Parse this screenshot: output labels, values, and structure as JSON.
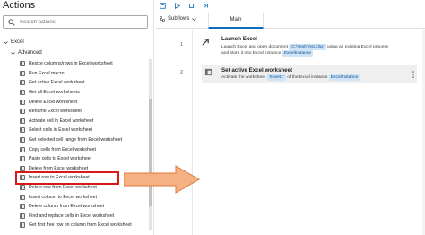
{
  "panel": {
    "title": "Actions",
    "search_placeholder": "Search actions",
    "category": "Excel",
    "subcategory": "Advanced",
    "items": [
      "Resize columns/rows in Excel worksheet",
      "Run Excel macro",
      "Get active Excel worksheet",
      "Get all Excel worksheets",
      "Delete Excel worksheet",
      "Rename Excel worksheet",
      "Activate cell in Excel worksheet",
      "Select cells in Excel worksheet",
      "Get selected cell range from Excel worksheet",
      "Copy cells from Excel worksheet",
      "Paste cells to Excel worksheet",
      "Delete from Excel worksheet",
      "Insert row to Excel worksheet",
      "Delete row from Excel worksheet",
      "Insert column to Excel worksheet",
      "Delete column from Excel worksheet",
      "Find and replace cells in Excel worksheet",
      "Get first free row on column from Excel worksheet"
    ],
    "highlighted_index": 12
  },
  "editor": {
    "subflows_label": "Subflows",
    "main_tab": "Main",
    "steps": [
      {
        "number": "1",
        "title": "Launch Excel",
        "desc_a": "Launch Excel and open document ",
        "tag1": "'C:\\Test\\Test.xlsx'",
        "desc_b": " using an existing Excel process",
        "desc_c": "and store it into Excel instance ",
        "tag2": "ExcelInstance"
      },
      {
        "number": "2",
        "title": "Set active Excel worksheet",
        "desc_a": "Activate the worksheet ",
        "tag1": "'Sheet1'",
        "desc_b": " of the Excel instance ",
        "tag2": "ExcelInstance"
      }
    ]
  },
  "colors": {
    "highlight": "#d7191c",
    "arrow": "#f4b183",
    "arrow_stroke": "#e07a3a",
    "tag_bg": "#cfe4f7",
    "accent": "#0f6cbd"
  }
}
